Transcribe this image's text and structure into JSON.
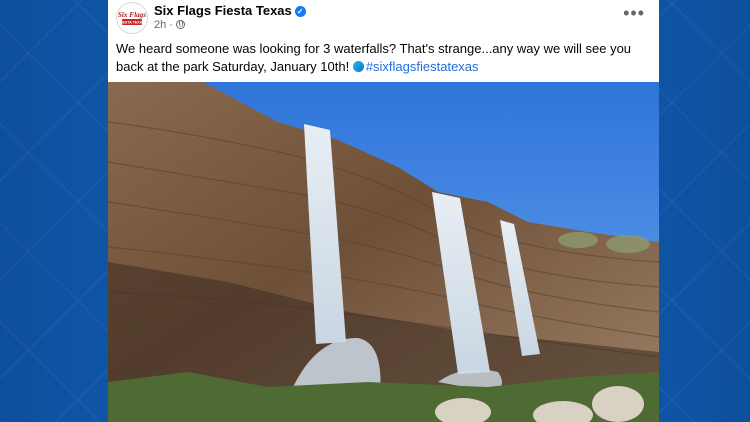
{
  "post": {
    "page_name": "Six Flags Fiesta Texas",
    "time": "2h",
    "separator": " · ",
    "verified_icon": "verified-badge-icon",
    "privacy_icon": "globe-icon",
    "more_label": "•••",
    "text": "We heard someone was looking for 3 waterfalls? That's strange...any way we will see you back at the park Saturday, January 10th!",
    "hashtag": "#sixflagsfiestatexas",
    "avatar_logo": {
      "line1": "Six Flags",
      "line2": "FIESTA TEXAS"
    }
  },
  "colors": {
    "background": "#0f5cb3",
    "card": "#ffffff",
    "name_text": "#050505",
    "meta_text": "#65676b",
    "hashtag": "#216fdb",
    "verified": "#1877f2",
    "sky": "#3f86e6"
  }
}
